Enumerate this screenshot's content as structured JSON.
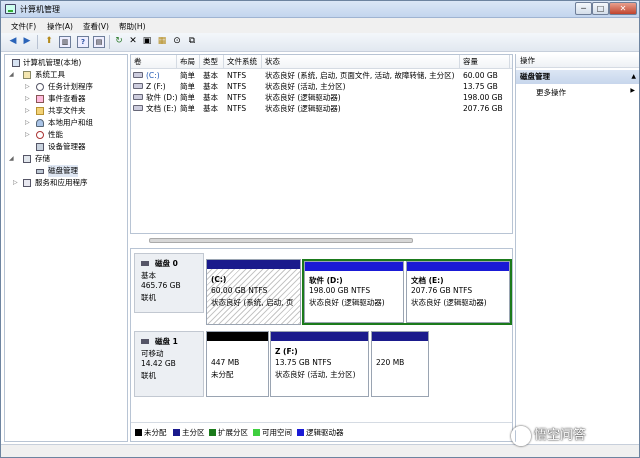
{
  "window": {
    "title": "计算机管理",
    "minimize": "─",
    "maximize": "□",
    "close": "✕"
  },
  "menu": [
    "文件(F)",
    "操作(A)",
    "查看(V)",
    "帮助(H)"
  ],
  "toolbar": {
    "back": "◀",
    "forward": "▶",
    "up": "⬆",
    "show_tree": "▥",
    "help": "?",
    "properties": "▤",
    "refresh": "↻",
    "delete": "✕",
    "open": "▣",
    "new_folder": "▦",
    "search": "⊙",
    "export": "⧉"
  },
  "nav": {
    "root": "计算机管理(本地)",
    "system_tools": "系统工具",
    "task_scheduler": "任务计划程序",
    "event_viewer": "事件查看器",
    "shared_folders": "共享文件夹",
    "local_users": "本地用户和组",
    "performance": "性能",
    "device_manager": "设备管理器",
    "storage": "存储",
    "disk_management": "磁盘管理",
    "services": "服务和应用程序"
  },
  "volume_table": {
    "headers": [
      "卷",
      "布局",
      "类型",
      "文件系统",
      "状态",
      "容量"
    ],
    "rows": [
      {
        "vol": "(C:)",
        "layout": "简单",
        "type": "基本",
        "fs": "NTFS",
        "status": "状态良好 (系统, 启动, 页面文件, 活动, 故障转储, 主分区)",
        "capacity": "60.00 GB"
      },
      {
        "vol": "Z (F:)",
        "layout": "简单",
        "type": "基本",
        "fs": "NTFS",
        "status": "状态良好 (活动, 主分区)",
        "capacity": "13.75 GB"
      },
      {
        "vol": "软件 (D:)",
        "layout": "简单",
        "type": "基本",
        "fs": "NTFS",
        "status": "状态良好 (逻辑驱动器)",
        "capacity": "198.00 GB"
      },
      {
        "vol": "文档 (E:)",
        "layout": "简单",
        "type": "基本",
        "fs": "NTFS",
        "status": "状态良好 (逻辑驱动器)",
        "capacity": "207.76 GB"
      }
    ]
  },
  "disk0": {
    "name": "磁盘 0",
    "type": "基本",
    "size": "465.76 GB",
    "state": "联机",
    "c": {
      "name": "(C:)",
      "size": "60.00 GB NTFS",
      "status": "状态良好 (系统, 启动, 页"
    },
    "d": {
      "name": "软件  (D:)",
      "size": "198.00 GB NTFS",
      "status": "状态良好 (逻辑驱动器)"
    },
    "e": {
      "name": "文档  (E:)",
      "size": "207.76 GB NTFS",
      "status": "状态良好 (逻辑驱动器)"
    }
  },
  "disk1": {
    "name": "磁盘 1",
    "type": "可移动",
    "size": "14.42 GB",
    "state": "联机",
    "unalloc": {
      "size": "447 MB",
      "status": "未分配"
    },
    "z": {
      "name": "Z  (F:)",
      "size": "13.75 GB NTFS",
      "status": "状态良好 (活动, 主分区)"
    },
    "p3": {
      "size": "220 MB"
    }
  },
  "legend": [
    {
      "label": "未分配",
      "color": "#000000"
    },
    {
      "label": "主分区",
      "color": "#1a1a8c"
    },
    {
      "label": "扩展分区",
      "color": "#1b7a1b"
    },
    {
      "label": "可用空间",
      "color": "#3fcf3f"
    },
    {
      "label": "逻辑驱动器",
      "color": "#1a1ad6"
    }
  ],
  "actions": {
    "header": "操作",
    "section": "磁盘管理",
    "section_arrow": "▲",
    "more": "更多操作",
    "more_arrow": "▶"
  },
  "watermark": "悟空问答"
}
